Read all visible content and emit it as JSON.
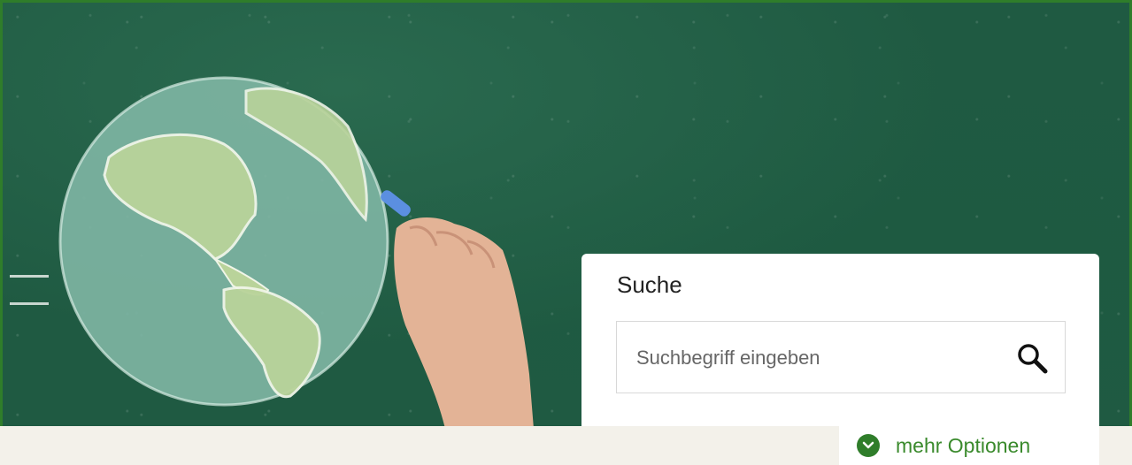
{
  "hero": {
    "image_subject": "earth-chalk-drawing"
  },
  "search": {
    "title": "Suche",
    "placeholder": "Suchbegriff eingeben",
    "value": "",
    "button_icon": "magnifier-icon"
  },
  "options": {
    "label": "mehr Optionen",
    "icon": "chevron-down-circle-icon"
  },
  "colors": {
    "chalkboard": "#1f5a42",
    "accent_green": "#2f7d2a",
    "link_green": "#3a8a2c",
    "footer_band": "#f3f1ea"
  }
}
